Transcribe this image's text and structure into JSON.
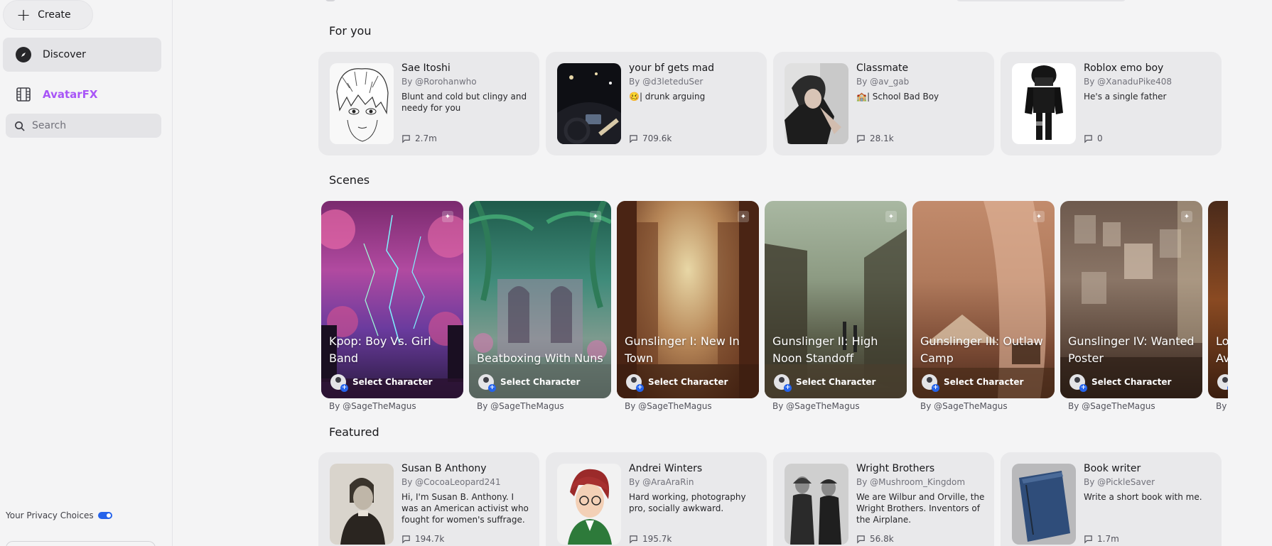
{
  "sidebar": {
    "create_label": "Create",
    "nav": [
      {
        "label": "Discover",
        "icon": "compass-icon",
        "active": true
      },
      {
        "label": "AvatarFX",
        "icon": "film-icon",
        "active": false
      }
    ],
    "search_placeholder": "Search",
    "privacy_label": "Your Privacy Choices"
  },
  "sections": {
    "for_you": "For you",
    "scenes": "Scenes",
    "featured": "Featured"
  },
  "for_you_cards": [
    {
      "name": "Sae Itoshi",
      "by": "By @Rorohanwho",
      "desc": "Blunt and cold but clingy and needy for you",
      "count": "2.7m"
    },
    {
      "name": "your bf gets mad",
      "by": "By @d3leteduSer",
      "desc": "🥴| drunk arguing",
      "count": "709.6k"
    },
    {
      "name": "Classmate",
      "by": "By @av_gab",
      "desc": "🏫| School Bad Boy",
      "count": "28.1k"
    },
    {
      "name": "Roblox emo boy",
      "by": "By @XanaduPike408",
      "desc": "He's a single father",
      "count": "0"
    }
  ],
  "scenes": [
    {
      "title": "Kpop: Boy Vs. Girl Band",
      "select": "Select Character",
      "by": "By @SageTheMagus"
    },
    {
      "title": "Beatboxing With Nuns",
      "select": "Select Character",
      "by": "By @SageTheMagus"
    },
    {
      "title": "Gunslinger I: New In Town",
      "select": "Select Character",
      "by": "By @SageTheMagus"
    },
    {
      "title": "Gunslinger II: High Noon Standoff",
      "select": "Select Character",
      "by": "By @SageTheMagus"
    },
    {
      "title": "Gunslinger III: Outlaw Camp",
      "select": "Select Character",
      "by": "By @SageTheMagus"
    },
    {
      "title": "Gunslinger IV: Wanted Poster",
      "select": "Select Character",
      "by": "By @SageTheMagus"
    },
    {
      "title": "Lo Av",
      "select": "",
      "by": "By"
    }
  ],
  "featured_cards": [
    {
      "name": "Susan B Anthony",
      "by": "By @CocoaLeopard241",
      "desc": "Hi, I'm Susan B. Anthony. I was an American activist who fought for women's suffrage.",
      "count": "194.7k"
    },
    {
      "name": "Andrei Winters",
      "by": "By @AraAraRin",
      "desc": "Hard working, photography pro, socially awkward.",
      "count": "195.7k"
    },
    {
      "name": "Wright Brothers",
      "by": "By @Mushroom_Kingdom",
      "desc": "We are Wilbur and Orville, the Wright Brothers. Inventors of the Airplane.",
      "count": "56.8k"
    },
    {
      "name": "Book writer",
      "by": "By @PickleSaver",
      "desc": "Write a short book with me.",
      "count": "1.7m"
    }
  ],
  "colors": {
    "avatarfx_label": "#a855f7",
    "privacy_toggle": "#2563eb",
    "background": "#f4f4f5",
    "card": "#e9e9eb"
  }
}
